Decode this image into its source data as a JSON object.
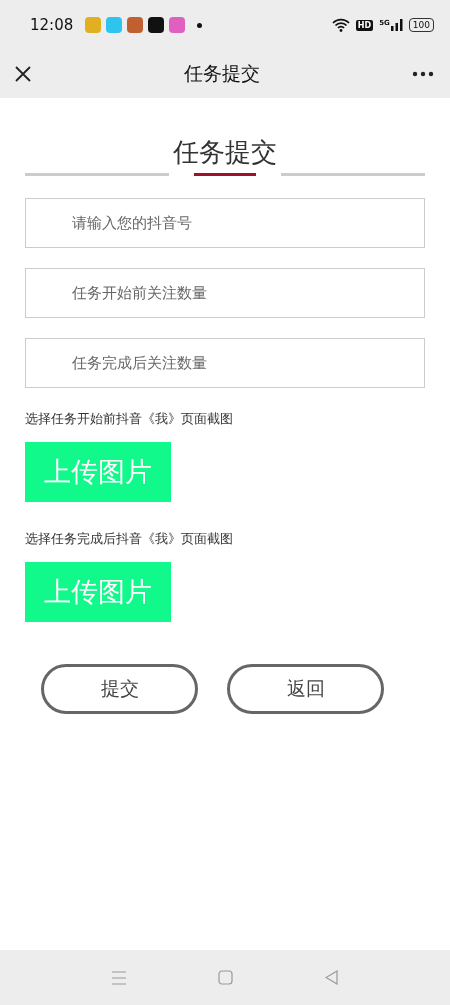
{
  "status_bar": {
    "time": "12:08",
    "network_badge": "HD",
    "signal_label": "5G",
    "battery": "100",
    "notification_apps": [
      {
        "color": "#e0b020"
      },
      {
        "color": "#2ec4f0"
      },
      {
        "color": "#c06030"
      },
      {
        "color": "#111111"
      },
      {
        "color": "#e060c0"
      }
    ]
  },
  "nav_bar": {
    "title": "任务提交"
  },
  "form": {
    "title": "任务提交",
    "fields": [
      {
        "placeholder": "请输入您的抖音号"
      },
      {
        "placeholder": "任务开始前关注数量"
      },
      {
        "placeholder": "任务完成后关注数量"
      }
    ],
    "uploads": [
      {
        "label": "选择任务开始前抖音《我》页面截图",
        "button": "上传图片"
      },
      {
        "label": "选择任务完成后抖音《我》页面截图",
        "button": "上传图片"
      }
    ],
    "buttons": [
      "提交",
      "返回"
    ]
  }
}
